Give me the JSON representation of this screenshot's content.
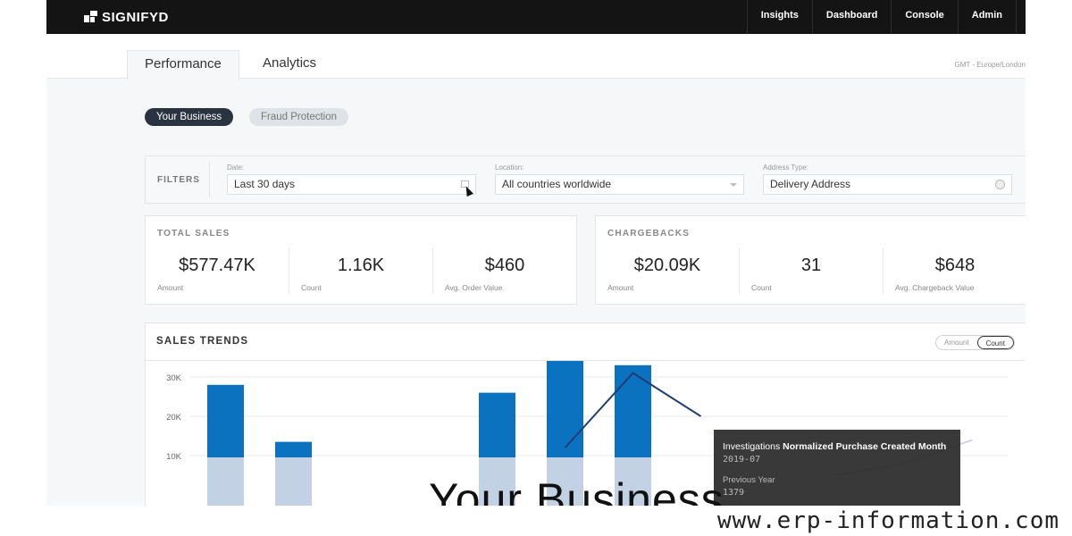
{
  "brand": {
    "name": "SIGNIFYD"
  },
  "nav": [
    {
      "label": "Insights"
    },
    {
      "label": "Dashboard"
    },
    {
      "label": "Console"
    },
    {
      "label": "Admin"
    }
  ],
  "tabs": [
    {
      "label": "Performance",
      "active": true
    },
    {
      "label": "Analytics",
      "active": false
    }
  ],
  "timezone": "GMT - Europe/London",
  "pills": [
    {
      "label": "Your Business",
      "active": true
    },
    {
      "label": "Fraud Protection",
      "active": false
    }
  ],
  "filters": {
    "label": "FILTERS",
    "date": {
      "label": "Date:",
      "value": "Last 30 days"
    },
    "location": {
      "label": "Location:",
      "value": "All countries worldwide"
    },
    "address": {
      "label": "Address Type:",
      "value": "Delivery Address"
    }
  },
  "total_sales": {
    "title": "TOTAL SALES",
    "stats": [
      {
        "value": "$577.47K",
        "label": "Amount"
      },
      {
        "value": "1.16K",
        "label": "Count"
      },
      {
        "value": "$460",
        "label": "Avg. Order Value"
      }
    ]
  },
  "chargebacks": {
    "title": "CHARGEBACKS",
    "stats": [
      {
        "value": "$20.09K",
        "label": "Amount"
      },
      {
        "value": "31",
        "label": "Count"
      },
      {
        "value": "$648",
        "label": "Avg. Chargeback Value"
      }
    ]
  },
  "sales_trends": {
    "title": "SALES TRENDS",
    "toggle": [
      {
        "label": "Amount",
        "active": false
      },
      {
        "label": "Count",
        "active": true
      }
    ]
  },
  "chart_data": {
    "type": "bar",
    "title": "",
    "y_ticks": [
      "30K",
      "20K",
      "10K"
    ],
    "ylim": [
      0,
      40000
    ],
    "colors": {
      "current": "#0b72c0",
      "previous": "#b8c9e1",
      "line": "#1f3d73"
    },
    "series": [
      {
        "values": [
          28000,
          13500,
          null,
          null,
          26000,
          37000,
          33000,
          null,
          null,
          null,
          null,
          null
        ]
      }
    ],
    "line_values": [
      null,
      null,
      null,
      null,
      null,
      12000,
      31000,
      20000,
      null,
      5000,
      8000,
      14000
    ]
  },
  "tooltip": {
    "prefix": "Investigations",
    "bold": "Normalized Purchase Created Month",
    "value": "2019-07",
    "sub_label": "Previous Year",
    "sub_value": "1379"
  },
  "overlay_title": "Your Business",
  "watermark": "www.erp-information.com"
}
